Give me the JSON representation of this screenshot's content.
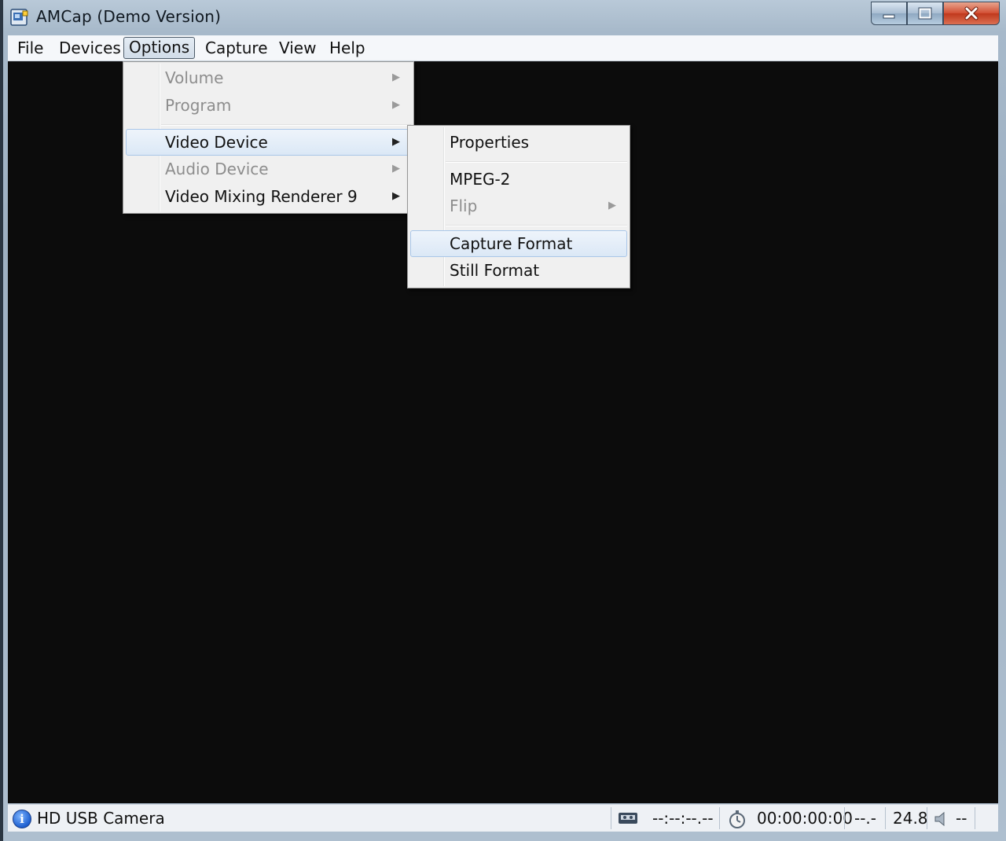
{
  "window": {
    "title": "AMCap (Demo Version)",
    "controls": {
      "minimize": "minimize-icon",
      "maximize": "maximize-icon",
      "close": "close-icon"
    }
  },
  "menubar": [
    {
      "label": "File"
    },
    {
      "label": "Devices"
    },
    {
      "label": "Options",
      "active": true
    },
    {
      "label": "Capture"
    },
    {
      "label": "View"
    },
    {
      "label": "Help"
    }
  ],
  "options_menu": {
    "items": [
      {
        "label": "Volume",
        "disabled": true,
        "submenu": true
      },
      {
        "label": "Program",
        "disabled": true,
        "submenu": true
      },
      {
        "label": "Video Device",
        "disabled": false,
        "submenu": true,
        "highlighted": true
      },
      {
        "label": "Audio Device",
        "disabled": true,
        "submenu": true
      },
      {
        "label": "Video Mixing Renderer 9",
        "disabled": false,
        "submenu": true
      }
    ]
  },
  "video_device_submenu": {
    "items": [
      {
        "label": "Properties",
        "disabled": false
      },
      {
        "label": "MPEG-2",
        "disabled": false
      },
      {
        "label": "Flip",
        "disabled": true,
        "submenu": true
      },
      {
        "label": "Capture Format",
        "disabled": false,
        "highlighted": true
      },
      {
        "label": "Still Format",
        "disabled": false
      }
    ]
  },
  "statusbar": {
    "device": "HD USB Camera",
    "device_icon": "info-icon",
    "tape_icon": "cassette-icon",
    "timecode": "--:--:--.--",
    "timer_icon": "stopwatch-icon",
    "elapsed": "00:00:00:00",
    "dropped": "--.-",
    "fps": "24.8",
    "speaker_icon": "speaker-icon",
    "volume": "--"
  }
}
